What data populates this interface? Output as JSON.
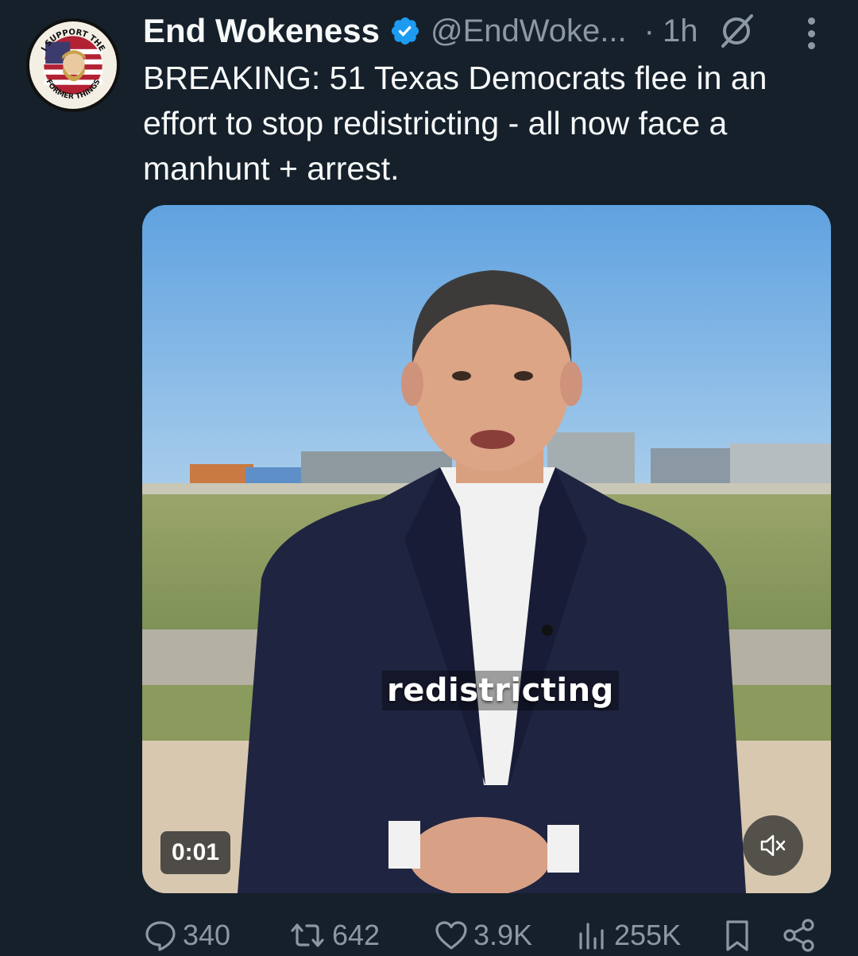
{
  "author": {
    "display_name": "End Wokeness",
    "handle": "@EndWoke...",
    "verified": true,
    "avatar_text_top": "I SUPPORT THE",
    "avatar_text_bottom": "FORMER THINGS"
  },
  "meta": {
    "separator": "·",
    "time": "1h"
  },
  "tweet": {
    "text": "BREAKING: 51 Texas Democrats flee in an effort to stop redistricting - all now face a manhunt + arrest."
  },
  "media": {
    "type": "video",
    "caption": "redistricting",
    "elapsed": "0:01",
    "muted": true
  },
  "stats": {
    "replies": "340",
    "reposts": "642",
    "likes": "3.9K",
    "views": "255K"
  },
  "icons": {
    "verified": "verified-badge-icon",
    "grok": "grok-icon",
    "more": "more-dots-icon",
    "mute": "speaker-muted-icon",
    "reply": "reply-bubble-icon",
    "repost": "repost-arrows-icon",
    "like": "heart-icon",
    "views": "views-bars-icon",
    "bookmark": "bookmark-icon",
    "share": "share-icon"
  },
  "colors": {
    "background": "#15202b",
    "primary_text": "#f7f9f9",
    "secondary_text": "#8b98a5",
    "verified_blue": "#1d9bf0"
  }
}
